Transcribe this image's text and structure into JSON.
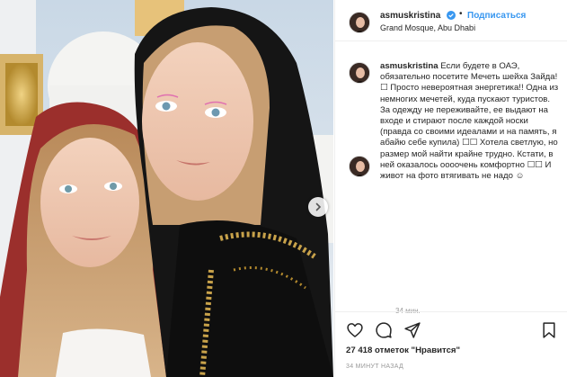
{
  "post": {
    "username": "asmuskristina",
    "follow_label": "Подписаться",
    "separator": "•",
    "location": "Grand Mosque, Abu Dhabi",
    "caption_user": "asmuskristina",
    "caption_text": " Если будете в ОАЭ, обязательно посетите Мечеть шейха Зайда! ☐ Просто невероятная энергетика!! Одна из немногих мечетей, куда пускают туристов. За одежду не переживайте, ее выдают на входе и стирают после каждой носки (правда со своими идеалами и на память, я абайю себе купила) ☐☐ Хотела светлую, но размер мой найти крайне трудно. Кстати, в ней оказалось оооочень комфортно ☐☐ И живот на фото втягивать не надо ☺",
    "caption_time": "34 мин.",
    "likes": "27 418 отметок \"Нравится\"",
    "time_ago": "34 МИНУТ НАЗАД"
  },
  "icons": {
    "verified": "verified-badge-icon",
    "like": "heart-icon",
    "comment": "comment-bubble-icon",
    "share": "share-arrow-icon",
    "save": "bookmark-icon",
    "carousel": "chevron-right-icon"
  },
  "colors": {
    "link_blue": "#3897f0",
    "text": "#262626",
    "muted": "#999999",
    "divider": "#efefef"
  }
}
